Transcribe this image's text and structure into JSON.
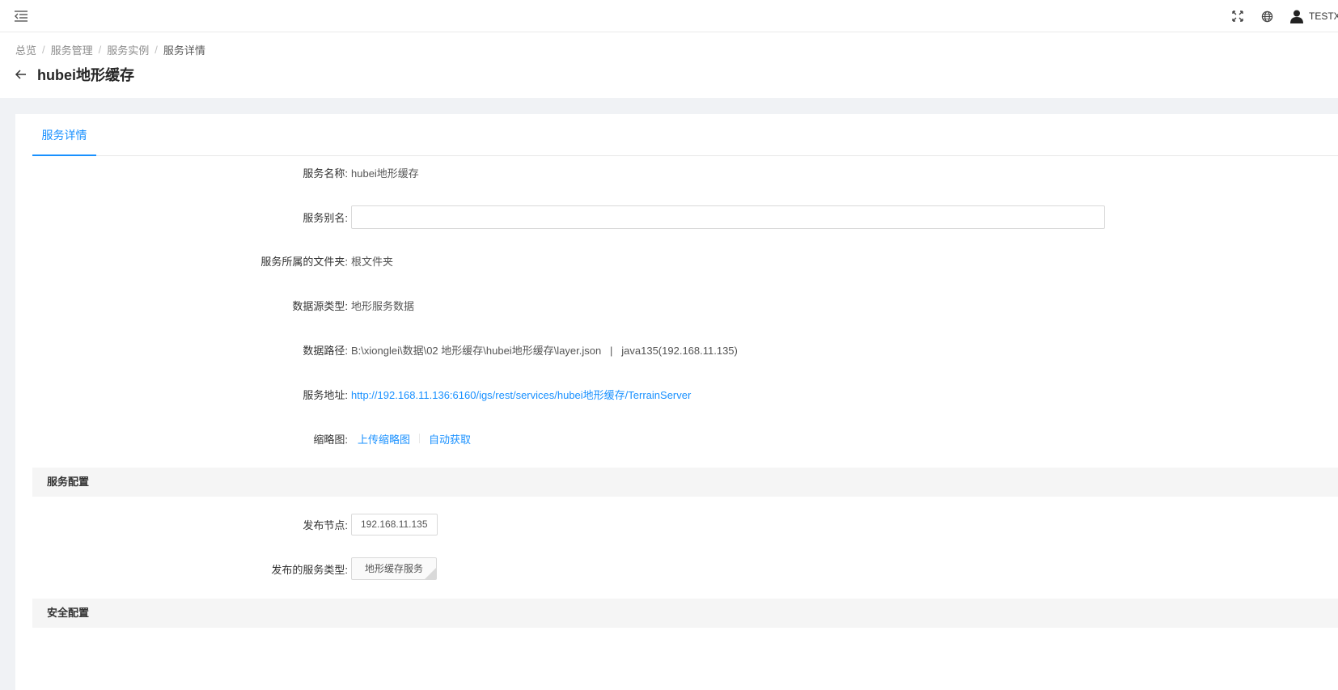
{
  "topbar": {
    "user_name": "TESTX"
  },
  "breadcrumb": [
    "总览",
    "服务管理",
    "服务实例",
    "服务详情"
  ],
  "header": {
    "title": "hubei地形缓存"
  },
  "tabs": [
    {
      "label": "服务详情"
    }
  ],
  "details": {
    "service_name_label": "服务名称:",
    "service_name_value": "hubei地形缓存",
    "alias_label": "服务别名:",
    "alias_value": "",
    "folder_label": "服务所属的文件夹:",
    "folder_value": "根文件夹",
    "source_type_label": "数据源类型:",
    "source_type_value": "地形服务数据",
    "path_label": "数据路径:",
    "path_value": "B:\\xionglei\\数据\\02 地形缓存\\hubei地形缓存\\layer.json   |   java135(192.168.11.135)",
    "address_label": "服务地址:",
    "address_value": "http://192.168.11.136:6160/igs/rest/services/hubei地形缓存/TerrainServer",
    "thumbnail_label": "缩略图:",
    "upload_thumbnail": "上传缩略图",
    "auto_fetch": "自动获取"
  },
  "service_config": {
    "section_title": "服务配置",
    "node_label": "发布节点:",
    "node_value": "192.168.11.135",
    "type_label": "发布的服务类型:",
    "type_value": "地形缓存服务"
  },
  "security_config": {
    "section_title": "安全配置"
  },
  "colors": {
    "accent": "#1890ff",
    "page_bg": "#f0f2f5",
    "section_bg": "#f5f5f5"
  }
}
